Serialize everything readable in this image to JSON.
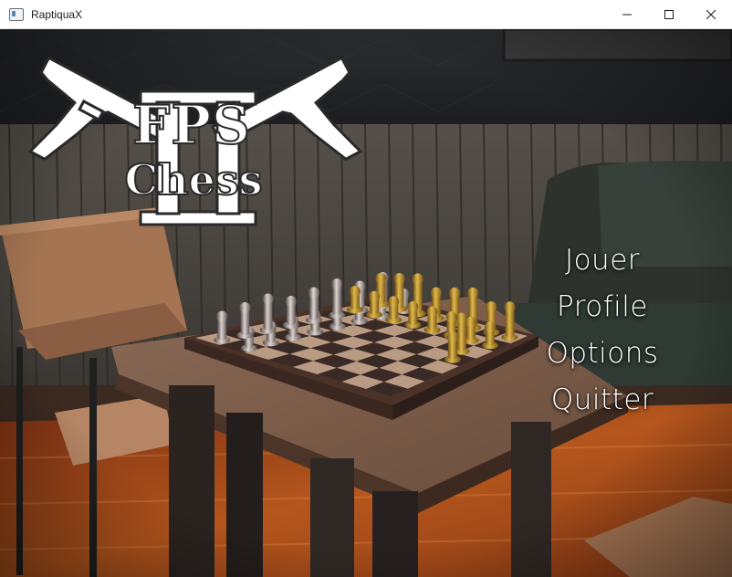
{
  "window": {
    "title": "RaptiquaX",
    "controls": {
      "minimize": "minimize-icon",
      "maximize": "maximize-icon",
      "close": "close-icon"
    }
  },
  "logo": {
    "title": "FPS",
    "subtitle": "Chess",
    "numeral": "II"
  },
  "menu": {
    "items": [
      {
        "label": "Jouer"
      },
      {
        "label": "Profile"
      },
      {
        "label": "Options"
      },
      {
        "label": "Quitter"
      }
    ]
  },
  "colors": {
    "wall": "#4e4a45",
    "wood_table": "#7a5a45",
    "board_light": "#b99a83",
    "board_dark": "#3a2a25",
    "rug": "#b6541c",
    "gold_piece": "#c89a30",
    "silver_piece": "#b0a8a6"
  }
}
